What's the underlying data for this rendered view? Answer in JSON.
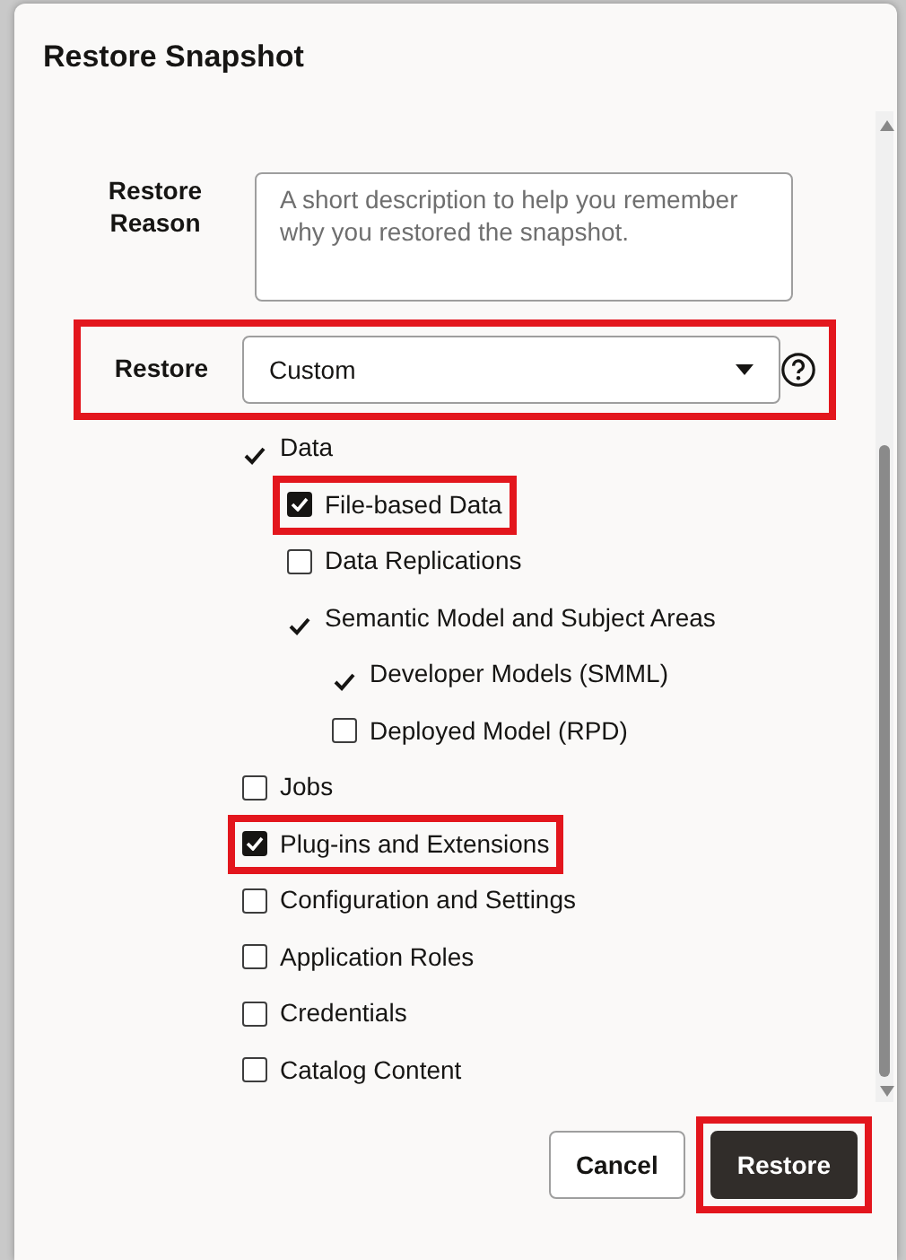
{
  "dialog": {
    "title": "Restore Snapshot"
  },
  "reason": {
    "label": "Restore Reason",
    "placeholder": "A short description to help you remember why you restored the snapshot."
  },
  "restore": {
    "label": "Restore",
    "value": "Custom",
    "highlighted": true
  },
  "tree": [
    {
      "label": "Data",
      "kind": "tick",
      "checked": true,
      "highlighted": false,
      "children": [
        {
          "label": "File-based Data",
          "kind": "checkbox",
          "checked": true,
          "highlighted": true
        },
        {
          "label": "Data Replications",
          "kind": "checkbox",
          "checked": false,
          "highlighted": false
        },
        {
          "label": "Semantic Model and Subject Areas",
          "kind": "tick",
          "checked": true,
          "highlighted": false,
          "children": [
            {
              "label": "Developer Models (SMML)",
              "kind": "tick",
              "checked": true,
              "highlighted": false
            },
            {
              "label": "Deployed Model (RPD)",
              "kind": "checkbox",
              "checked": false,
              "highlighted": false
            }
          ]
        }
      ]
    },
    {
      "label": "Jobs",
      "kind": "checkbox",
      "checked": false,
      "highlighted": false
    },
    {
      "label": "Plug-ins and Extensions",
      "kind": "checkbox",
      "checked": true,
      "highlighted": true
    },
    {
      "label": "Configuration and Settings",
      "kind": "checkbox",
      "checked": false,
      "highlighted": false
    },
    {
      "label": "Application Roles",
      "kind": "checkbox",
      "checked": false,
      "highlighted": false
    },
    {
      "label": "Credentials",
      "kind": "checkbox",
      "checked": false,
      "highlighted": false
    },
    {
      "label": "Catalog Content",
      "kind": "checkbox",
      "checked": false,
      "highlighted": false
    }
  ],
  "buttons": [
    {
      "label": "Cancel",
      "kind": "secondary",
      "highlighted": false
    },
    {
      "label": "Restore",
      "kind": "primary",
      "highlighted": true
    }
  ]
}
